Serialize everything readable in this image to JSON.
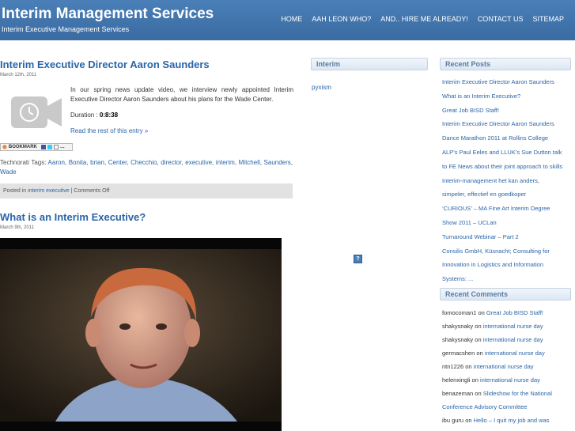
{
  "header": {
    "site_title": "Interim Management Services",
    "site_description": "Interim Executive Management Services",
    "nav": [
      {
        "label": "HOME"
      },
      {
        "label": "AAH LEON WHO?"
      },
      {
        "label": "AND.. HIRE ME ALREADY!"
      },
      {
        "label": "CONTACT US"
      },
      {
        "label": "SITEMAP"
      }
    ]
  },
  "post1": {
    "title": "Interim Executive Director Aaron Saunders",
    "date": "March 12th, 2011",
    "excerpt": "In our spring news update video, we interview newly appointed Interim Executive Director Aaron Saunders about his plans for the Wade Center.",
    "duration_label": "Duration :",
    "duration_value": "0:8:38",
    "read_more": "Read the rest of this entry »",
    "bookmark_label": "BOOKMARK",
    "tags_prefix": "Technorati Tags:",
    "tags": [
      "Aaron",
      "Bonita",
      "brian",
      "Center",
      "Checchio",
      "director",
      "executive",
      "interim",
      "Mitchell",
      "Saunders",
      "Wade"
    ],
    "posted_in_label": "Posted in",
    "category": "interim executive",
    "comments": "Comments Off"
  },
  "post2": {
    "title": "What is an Interim Executive?",
    "date": "March 9th, 2011"
  },
  "middle_widget": {
    "title": "Interim",
    "link": "pyxism",
    "help_icon": "?"
  },
  "recent_posts": {
    "title": "Recent Posts",
    "items": [
      "Interim Executive Director Aaron Saunders",
      "What is an Interim Executive?",
      "Great Job BISD Staff!",
      "Interim Executive Director Aaron Saunders",
      "Dance Marathon 2011 at Rollins College",
      "ALP’s Paul Eeles and LLUK’s Sue Dutton talk",
      "to FE News about their joint approach to skills",
      "Interim-management het kan anders,",
      "simpeler, effectief en goedkoper",
      "‘CURIOUS’ – MA Fine Art Interim Degree",
      "Show 2011 – UCLan",
      "Turnaround Webinar – Part 2",
      "Consilis GmbH, Küsnacht; Consulting for",
      "Innovation in Logistics and Information",
      "Systems: ..."
    ]
  },
  "recent_comments": {
    "title": "Recent Comments",
    "items": [
      {
        "author": "fomocoman1",
        "on": "on",
        "link": "Great Job BISD Staff!"
      },
      {
        "author": "shakysnaky",
        "on": "on",
        "link": "international nurse day"
      },
      {
        "author": "shakysnaky",
        "on": "on",
        "link": "international nurse day"
      },
      {
        "author": "germacshen",
        "on": "on",
        "link": "international nurse day"
      },
      {
        "author": "ntn1226",
        "on": "on",
        "link": "international nurse day"
      },
      {
        "author": "helenxingli",
        "on": "on",
        "link": "international nurse day"
      },
      {
        "author": "benazeman",
        "on": "on",
        "link": "Slideshow for the National"
      },
      {
        "author": "",
        "on": "",
        "link": "Conference Advisory Committee"
      },
      {
        "author": "ibu guru",
        "on": "on",
        "link": "Hello – I quit my job and was"
      }
    ]
  },
  "colors": {
    "header_bg": "#3f74ad",
    "link": "#2a65a8",
    "widget_title": "#5a7ca3"
  }
}
